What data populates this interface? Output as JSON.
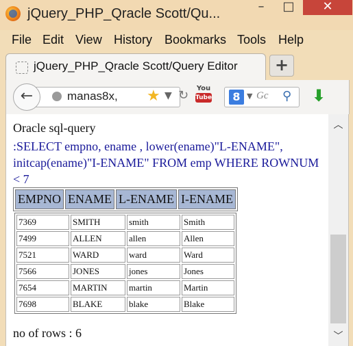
{
  "window": {
    "title": "jQuery_PHP_Qracle Scott/Qu...",
    "minimize": "–",
    "maximize": "□",
    "close": "✕"
  },
  "menu": {
    "items": [
      "File",
      "Edit",
      "View",
      "History",
      "Bookmarks",
      "Tools",
      "Help"
    ]
  },
  "tabs": [
    {
      "title": "jQuery_PHP_Qracle Scott/Query Editor"
    }
  ],
  "new_tab_label": "+",
  "nav": {
    "url": "manas8x,",
    "search_engine_letter": "8",
    "search_placeholder": "Gc"
  },
  "content": {
    "heading": "Oracle sql-query",
    "query": ":SELECT empno, ename , lower(ename)\"L-ENAME\", initcap(ename)\"I-ENAME\" FROM emp WHERE ROWNUM < 7",
    "columns": [
      "EMPNO",
      "ENAME",
      "L-ENAME",
      "I-ENAME"
    ],
    "rows": [
      [
        "7369",
        "SMITH",
        "smith",
        "Smith"
      ],
      [
        "7499",
        "ALLEN",
        "allen",
        "Allen"
      ],
      [
        "7521",
        "WARD",
        "ward",
        "Ward"
      ],
      [
        "7566",
        "JONES",
        "jones",
        "Jones"
      ],
      [
        "7654",
        "MARTIN",
        "martin",
        "Martin"
      ],
      [
        "7698",
        "BLAKE",
        "blake",
        "Blake"
      ]
    ],
    "row_count_text": "no of rows : 6"
  }
}
